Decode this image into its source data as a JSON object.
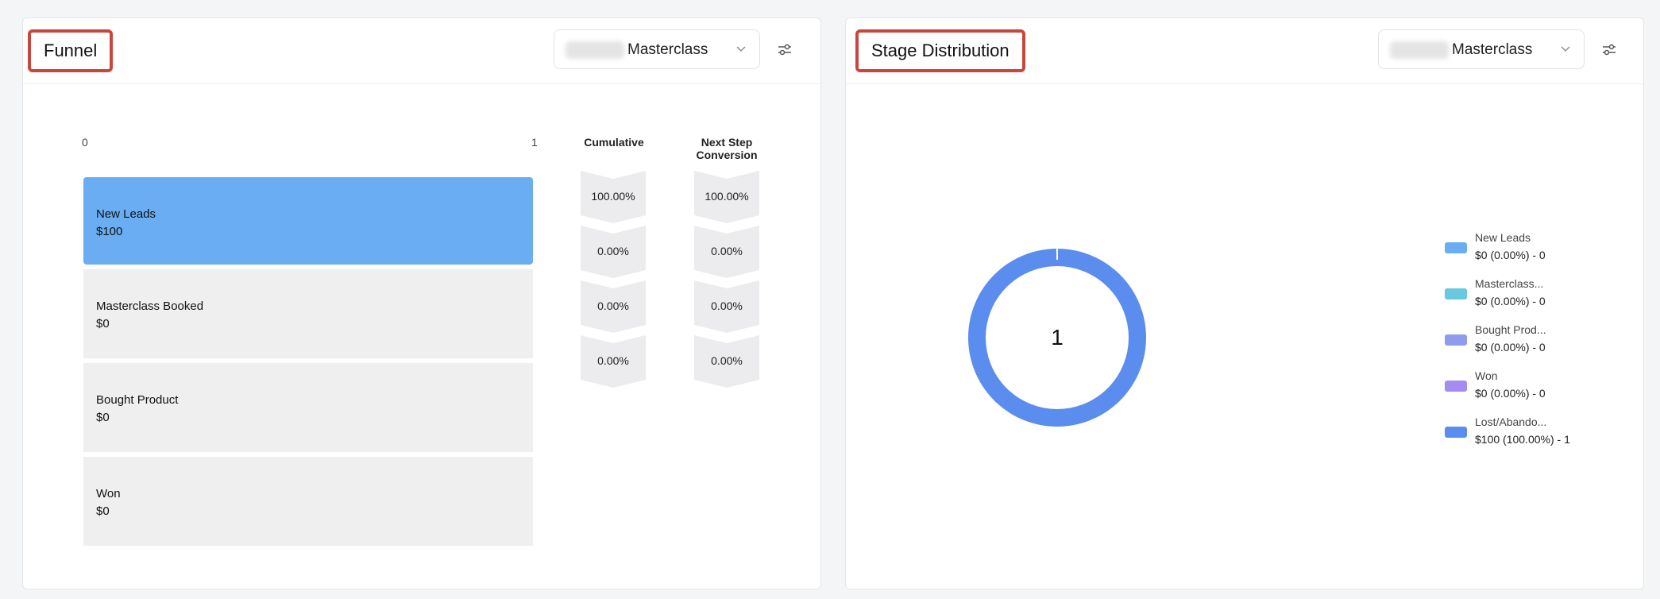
{
  "funnel_card": {
    "title": "Funnel",
    "pipeline_select": {
      "value": "Masterclass"
    },
    "axis": {
      "min_label": "0",
      "max_label": "1"
    },
    "columns": {
      "cumulative": "Cumulative",
      "next_step": "Next Step\nConversion"
    },
    "stages": [
      {
        "name": "New Leads",
        "value": "$100",
        "cumulative": "100.00%",
        "next_step": "100.00%",
        "active": true
      },
      {
        "name": "Masterclass Booked",
        "value": "$0",
        "cumulative": "0.00%",
        "next_step": "0.00%",
        "active": false
      },
      {
        "name": "Bought Product",
        "value": "$0",
        "cumulative": "0.00%",
        "next_step": "0.00%",
        "active": false
      },
      {
        "name": "Won",
        "value": "$0",
        "cumulative": "0.00%",
        "next_step": "0.00%",
        "active": false
      }
    ],
    "colors": {
      "active_bar": "#6aadf3",
      "inactive_bar": "#efefef"
    }
  },
  "stage_card": {
    "title": "Stage Distribution",
    "pipeline_select": {
      "value": "Masterclass"
    },
    "donut": {
      "center_label": "1"
    },
    "legend": [
      {
        "name": "New Leads",
        "value": "$0 (0.00%) - 0",
        "color": "#6aadf3"
      },
      {
        "name": "Masterclass...",
        "value": "$0 (0.00%) - 0",
        "color": "#67c8df"
      },
      {
        "name": "Bought Prod...",
        "value": "$0 (0.00%) - 0",
        "color": "#8e9cf0"
      },
      {
        "name": "Won",
        "value": "$0 (0.00%) - 0",
        "color": "#a58cf0"
      },
      {
        "name": "Lost/Abando...",
        "value": "$100 (100.00%) - 1",
        "color": "#5b8def"
      }
    ],
    "accent_color": "#c9463d"
  },
  "chart_data": {
    "type": "pie",
    "title": "Stage Distribution",
    "labels": [
      "New Leads",
      "Masterclass...",
      "Bought Prod...",
      "Won",
      "Lost/Abando..."
    ],
    "values": [
      0,
      0,
      0,
      0,
      100
    ],
    "counts": [
      0,
      0,
      0,
      0,
      1
    ],
    "center_label": "1",
    "legend_position": "right"
  }
}
